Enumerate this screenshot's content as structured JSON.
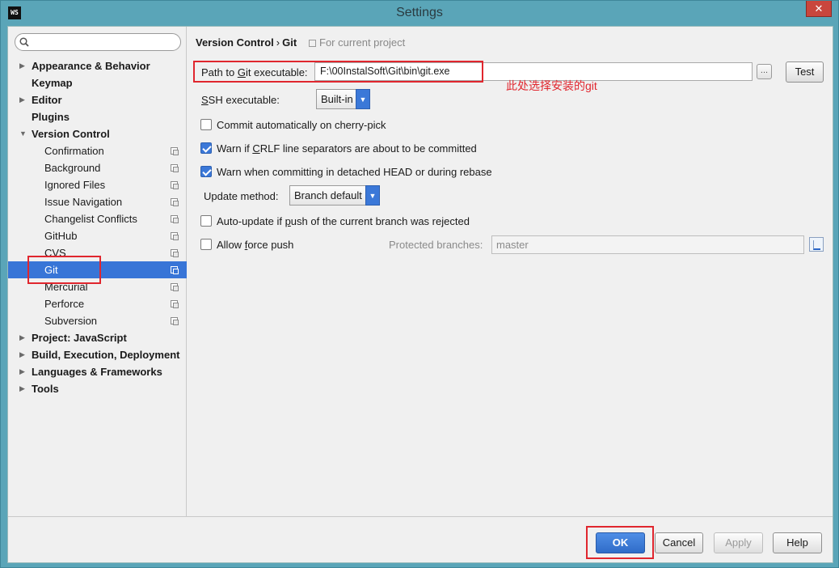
{
  "window": {
    "title": "Settings",
    "app_icon": "WS",
    "close_glyph": "✕"
  },
  "sidebar": {
    "search_placeholder": "",
    "items": [
      {
        "label": "Appearance & Behavior",
        "level": "top",
        "arrow": "▶"
      },
      {
        "label": "Keymap",
        "level": "top",
        "arrow": ""
      },
      {
        "label": "Editor",
        "level": "top",
        "arrow": "▶"
      },
      {
        "label": "Plugins",
        "level": "top",
        "arrow": ""
      },
      {
        "label": "Version Control",
        "level": "top",
        "arrow": "▼"
      },
      {
        "label": "Confirmation",
        "level": "child"
      },
      {
        "label": "Background",
        "level": "child"
      },
      {
        "label": "Ignored Files",
        "level": "child"
      },
      {
        "label": "Issue Navigation",
        "level": "child"
      },
      {
        "label": "Changelist Conflicts",
        "level": "child"
      },
      {
        "label": "GitHub",
        "level": "child"
      },
      {
        "label": "CVS",
        "level": "child"
      },
      {
        "label": "Git",
        "level": "child",
        "selected": true
      },
      {
        "label": "Mercurial",
        "level": "child"
      },
      {
        "label": "Perforce",
        "level": "child"
      },
      {
        "label": "Subversion",
        "level": "child"
      },
      {
        "label": "Project: JavaScript",
        "level": "top",
        "arrow": "▶"
      },
      {
        "label": "Build, Execution, Deployment",
        "level": "top",
        "arrow": "▶"
      },
      {
        "label": "Languages & Frameworks",
        "level": "top",
        "arrow": "▶"
      },
      {
        "label": "Tools",
        "level": "top",
        "arrow": "▶"
      }
    ]
  },
  "breadcrumb": {
    "parent": "Version Control",
    "separator": "›",
    "current": "Git",
    "note": "For current project"
  },
  "git": {
    "path_label": "Path to Git executable:",
    "path_value": "F:\\00InstalSoft\\Git\\bin\\git.exe",
    "browse_label": "...",
    "test_label": "Test",
    "annotation": "此处选择安装的git",
    "ssh_label": "SSH executable:",
    "ssh_value": "Built-in",
    "commit_cherry": "Commit automatically on cherry-pick",
    "warn_crlf": "Warn if CRLF line separators are about to be committed",
    "warn_detached": "Warn when committing in detached HEAD or during rebase",
    "update_method_label": "Update method:",
    "update_method_value": "Branch default",
    "auto_update": "Auto-update if push of the current branch was rejected",
    "allow_force": "Allow force push",
    "protected_label": "Protected branches:",
    "protected_value": "master",
    "checkbox_states": {
      "commit_cherry": false,
      "warn_crlf": true,
      "warn_detached": true,
      "auto_update": false,
      "allow_force": false
    }
  },
  "footer": {
    "ok": "OK",
    "cancel": "Cancel",
    "apply": "Apply",
    "help": "Help"
  },
  "colors": {
    "selection": "#3875d7",
    "annotation_red": "#e0262e",
    "frame": "#5aa5b8"
  }
}
